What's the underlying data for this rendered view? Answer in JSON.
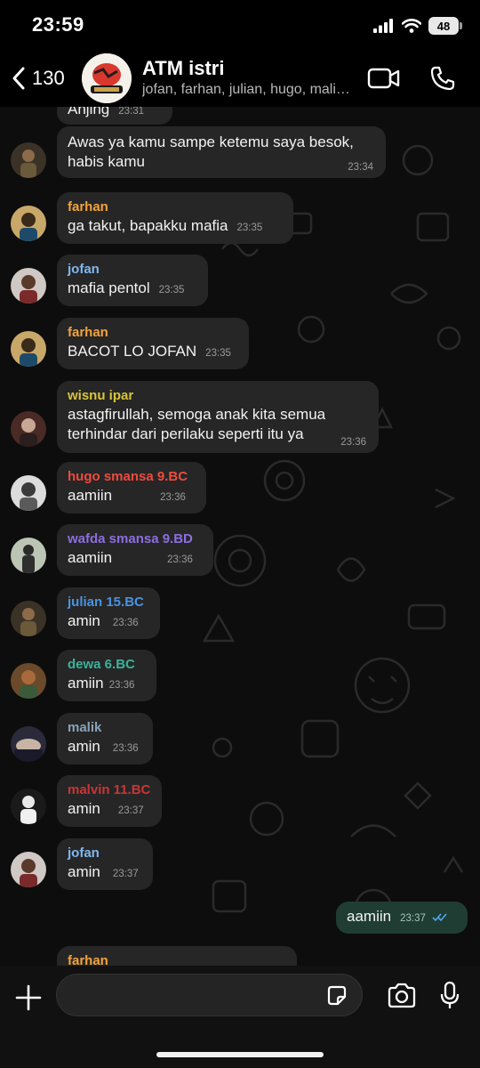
{
  "status_bar": {
    "time": "23:59",
    "battery": "48"
  },
  "header": {
    "back_count": "130",
    "title": "ATM istri",
    "subtitle": "jofan, farhan, julian, hugo, malik, malvin, wisnu, wafda, dewa"
  },
  "messages": [
    {
      "text": "Anjing",
      "time": "23:31"
    },
    {
      "text": "Awas ya kamu sampe ketemu saya besok, habis kamu",
      "time": "23:34"
    },
    {
      "sender": "farhan",
      "sender_color": "#f2a33a",
      "text": "ga takut, bapakku mafia",
      "time": "23:35"
    },
    {
      "sender": "jofan",
      "sender_color": "#7fb8f0",
      "text": "mafia pentol",
      "time": "23:35"
    },
    {
      "sender": "farhan",
      "sender_color": "#f2a33a",
      "text": "BACOT LO JOFAN",
      "time": "23:35"
    },
    {
      "sender": "wisnu ipar",
      "sender_color": "#d8c43a",
      "text": "astagfirullah, semoga anak kita semua terhindar dari perilaku seperti itu ya",
      "time": "23:36"
    },
    {
      "sender": "hugo smansa 9.BC",
      "sender_color": "#ee4b3e",
      "text": "aamiin",
      "time": "23:36"
    },
    {
      "sender": "wafda smansa 9.BD",
      "sender_color": "#8c6ee0",
      "text": "aamiin",
      "time": "23:36"
    },
    {
      "sender": "julian 15.BC",
      "sender_color": "#4a93e0",
      "text": "amin",
      "time": "23:36"
    },
    {
      "sender": "dewa 6.BC",
      "sender_color": "#3bb39a",
      "text": "amiin",
      "time": "23:36"
    },
    {
      "sender": "malik",
      "sender_color": "#8aa2b8",
      "text": "amin",
      "time": "23:36"
    },
    {
      "sender": "malvin 11.BC",
      "sender_color": "#c93535",
      "text": "amin",
      "time": "23:37"
    },
    {
      "sender": "jofan",
      "sender_color": "#7fb8f0",
      "text": "amin",
      "time": "23:37"
    },
    {
      "text": "aamiin",
      "time": "23:37",
      "outgoing": true,
      "read": true
    },
    {
      "sender": "farhan",
      "sender_color": "#f2a33a"
    }
  ],
  "composer": {
    "placeholder": ""
  },
  "colors": {
    "outgoing_bubble": "#1f3d33",
    "incoming_bubble": "#262626",
    "read_ticks": "#53a6f2"
  }
}
